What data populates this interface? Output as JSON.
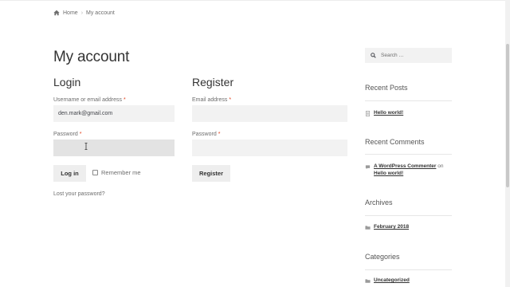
{
  "breadcrumb": {
    "home": "Home",
    "current": "My account"
  },
  "page": {
    "title": "My account"
  },
  "login": {
    "title": "Login",
    "username_label": "Username or email address",
    "username_value": "den.mark@gmail.com",
    "password_label": "Password",
    "required_mark": "*",
    "login_button": "Log in",
    "remember_label": "Remember me",
    "lost_password": "Lost your password?"
  },
  "register": {
    "title": "Register",
    "email_label": "Email address",
    "password_label": "Password",
    "register_button": "Register"
  },
  "sidebar": {
    "search_placeholder": "Search …",
    "recent_posts": {
      "title": "Recent Posts",
      "items": [
        "Hello world!"
      ]
    },
    "recent_comments": {
      "title": "Recent Comments",
      "author": "A WordPress Commenter",
      "on": "on",
      "post": "Hello world!"
    },
    "archives": {
      "title": "Archives",
      "items": [
        "February 2018"
      ]
    },
    "categories": {
      "title": "Categories",
      "items": [
        "Uncategorized"
      ]
    }
  },
  "colors": {
    "required": "#e2401c",
    "input_bg": "#f2f2f2",
    "button_bg": "#eeeeee"
  }
}
